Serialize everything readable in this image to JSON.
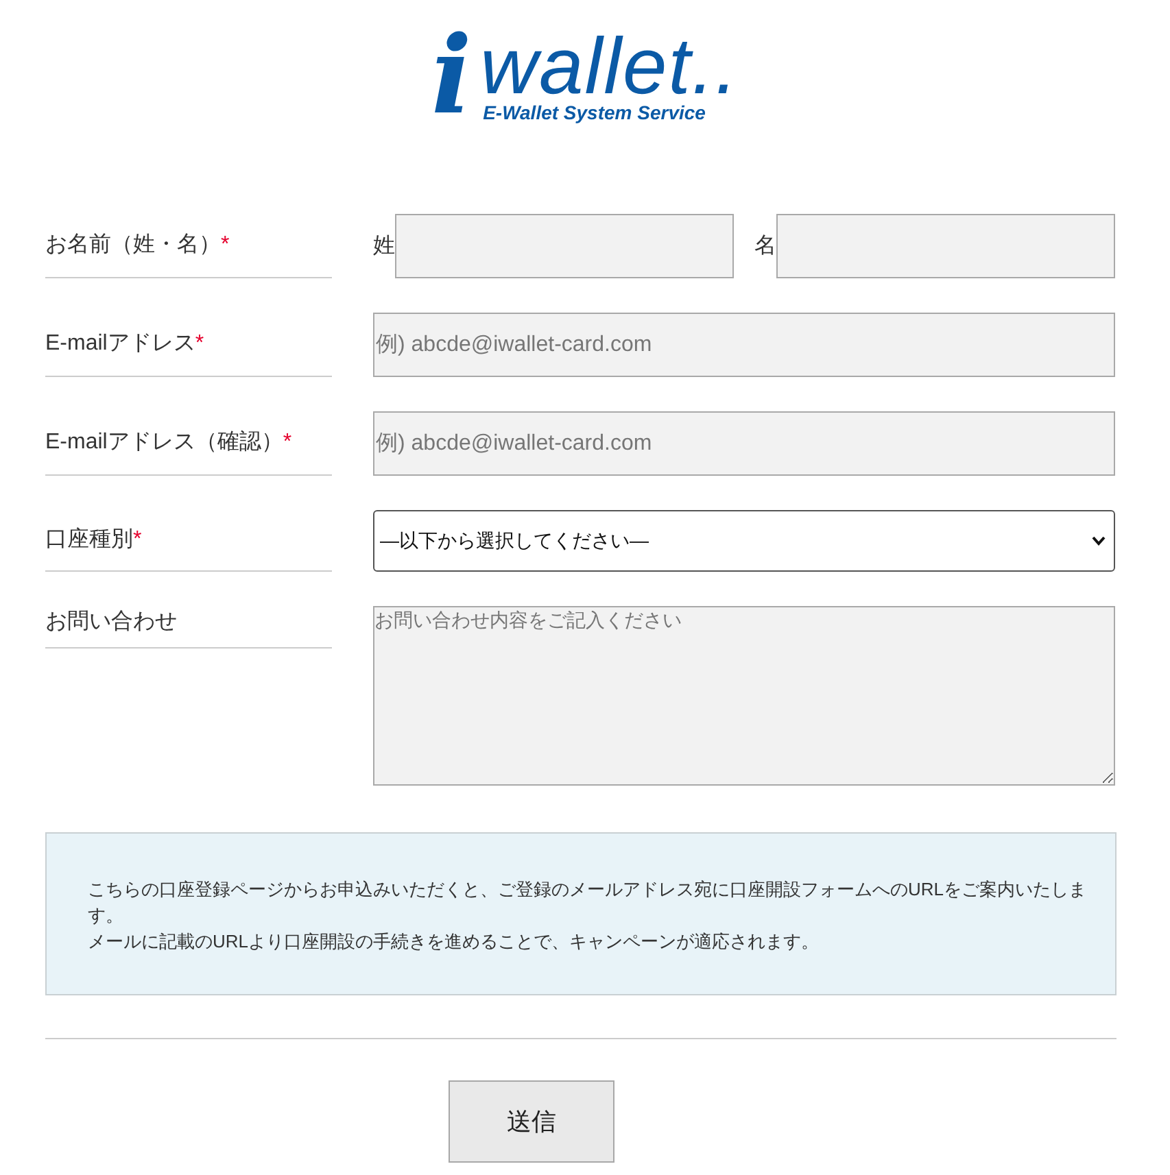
{
  "logo": {
    "mark": "i",
    "wordmark": "wallet..",
    "tagline": "E-Wallet System Service"
  },
  "form": {
    "fields": [
      {
        "kind": "name_pair",
        "label": "お名前（姓・名）",
        "mark": "*",
        "parts": [
          {
            "label": "姓"
          },
          {
            "label": "名"
          }
        ]
      },
      {
        "kind": "text",
        "label": "E-mailアドレス",
        "mark": "*",
        "placeholder": "例) abcde@iwallet-card.com"
      },
      {
        "kind": "text",
        "label": "E-mailアドレス（確認）",
        "mark": "*",
        "placeholder": "例) abcde@iwallet-card.com"
      },
      {
        "kind": "select",
        "label": "口座種別",
        "mark": "*",
        "value": "—以下から選択してください—"
      },
      {
        "kind": "textarea",
        "label": "お問い合わせ",
        "placeholder": "お問い合わせ内容をご記入ください"
      }
    ]
  },
  "notice": {
    "lines": [
      "こちらの口座登録ページからお申込みいただくと、ご登録のメールアドレス宛に口座開設フォームへのURLをご案内いたします。",
      "メールに記載のURLより口座開設の手続きを進めることで、キャンペーンが適応されます。"
    ]
  },
  "submit_button": "送信"
}
